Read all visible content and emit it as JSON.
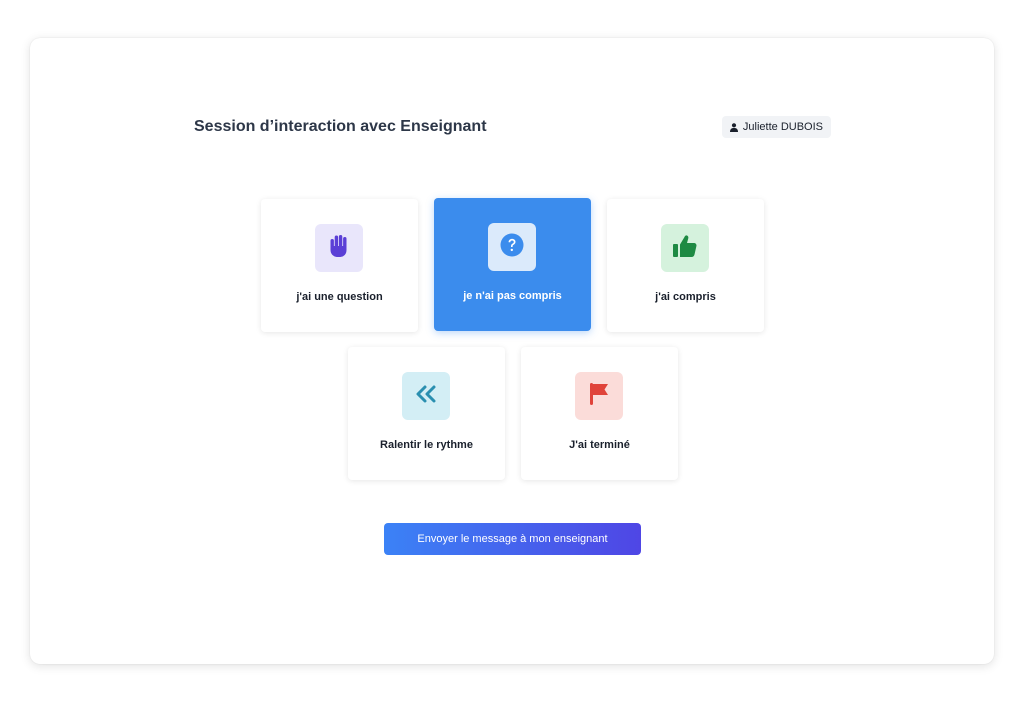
{
  "header": {
    "title": "Session d’interaction avec Enseignant",
    "user_name": "Juliette DUBOIS",
    "user_icon": "user-icon"
  },
  "options": [
    {
      "label": "j'ai une question",
      "icon": "raised-hand-icon",
      "bg": "#e9e6fb",
      "fg": "#5b3fd6",
      "selected": false
    },
    {
      "label": "je n'ai pas compris",
      "icon": "question-icon",
      "bg": "#dbeafb",
      "fg": "#3b8ced",
      "selected": true
    },
    {
      "label": "j'ai compris",
      "icon": "thumbs-up-icon",
      "bg": "#d5f2dd",
      "fg": "#1e8a43",
      "selected": false
    },
    {
      "label": "Ralentir le rythme",
      "icon": "double-chevron-left-icon",
      "bg": "#d3eef5",
      "fg": "#2a8fb0",
      "selected": false
    },
    {
      "label": "J'ai terminé",
      "icon": "flag-icon",
      "bg": "#fbdcd9",
      "fg": "#e0433a",
      "selected": false
    }
  ],
  "send_button_label": "Envoyer le message à mon enseignant",
  "colors": {
    "selected_card": "#3b8ced",
    "button_gradient_start": "#3b82f6",
    "button_gradient_end": "#4f46e5"
  }
}
